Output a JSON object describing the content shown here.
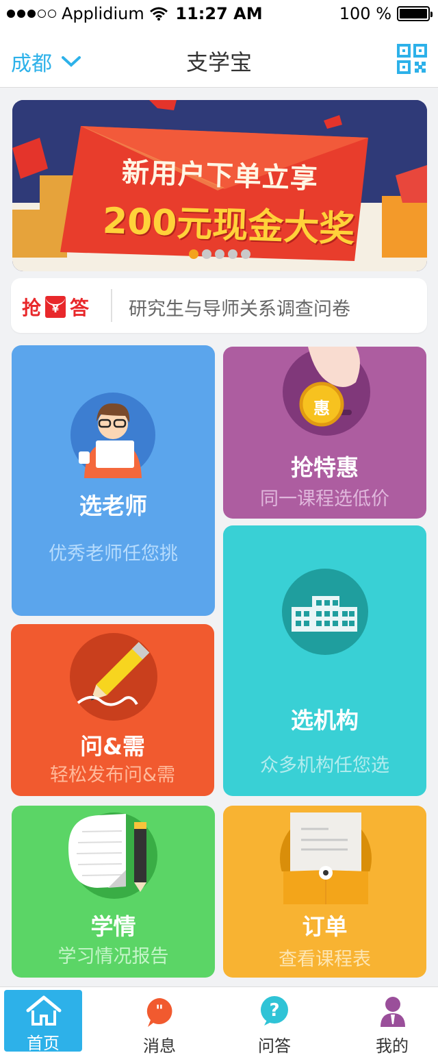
{
  "status_bar": {
    "carrier": "Applidium",
    "time": "11:27 AM",
    "battery": "100 %"
  },
  "nav": {
    "city": "成都",
    "title": "支学宝"
  },
  "banner": {
    "line1": "新用户下单立享",
    "line2": "200元现金大奖",
    "page_count": 5,
    "active_page": 1
  },
  "notice": {
    "tag_left": "抢",
    "tag_icon": "¥",
    "tag_right": "答",
    "text": "研究生与导师关系调查问卷"
  },
  "tiles": {
    "teacher": {
      "title": "选老师",
      "subtitle": "优秀老师任您挑",
      "icon": "teacher-icon"
    },
    "discount": {
      "title": "抢特惠",
      "subtitle": "同一课程选低价",
      "coin": "惠",
      "icon": "coin-hand-icon"
    },
    "organization": {
      "title": "选机构",
      "subtitle": "众多机构任您选",
      "icon": "building-icon"
    },
    "qa": {
      "title": "问&需",
      "subtitle": "轻松发布问&需",
      "icon": "pencil-icon"
    },
    "study": {
      "title": "学情",
      "subtitle": "学习情况报告",
      "icon": "notebook-icon"
    },
    "order": {
      "title": "订单",
      "subtitle": "查看课程表",
      "icon": "envelope-icon"
    }
  },
  "tabbar": {
    "home": "首页",
    "messages": "消息",
    "qa": "问答",
    "mine": "我的"
  },
  "colors": {
    "accent": "#2db1e9",
    "teacher": "#5ba5ec",
    "discount": "#ad5da0",
    "organization": "#39d0d5",
    "qa": "#f15a2f",
    "study": "#5bd566",
    "order": "#f8b332"
  }
}
